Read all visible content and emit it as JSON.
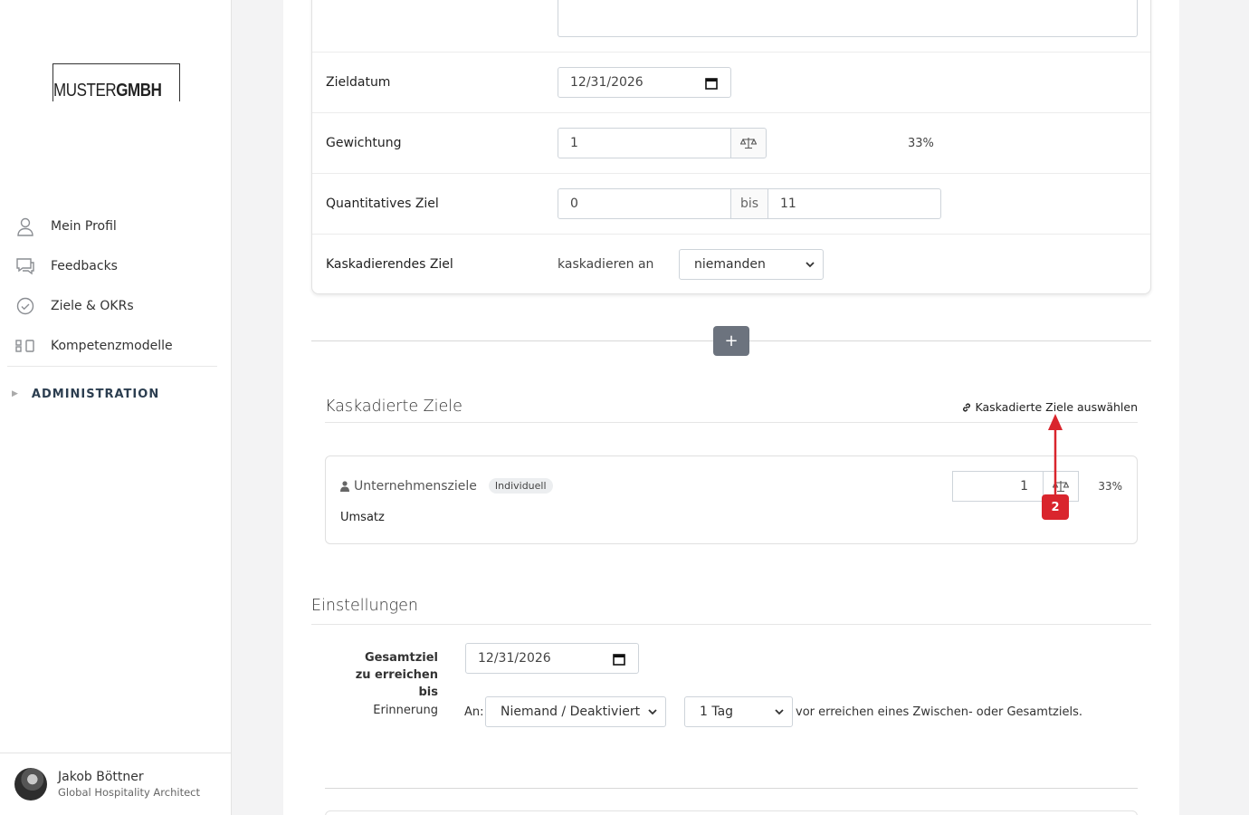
{
  "sidebar": {
    "logo_light": "MUSTER",
    "logo_bold": "GMBH",
    "nav": [
      {
        "label": "Mein Profil",
        "icon": "user-icon"
      },
      {
        "label": "Feedbacks",
        "icon": "chat-icon"
      },
      {
        "label": "Ziele & OKRs",
        "icon": "check-circle-icon"
      },
      {
        "label": "Kompetenzmodelle",
        "icon": "blocks-icon"
      }
    ],
    "admin_label": "ADMINISTRATION",
    "user": {
      "name": "Jakob Böttner",
      "role": "Global Hospitality Architect"
    }
  },
  "goal_form": {
    "zieldatum_label": "Zieldatum",
    "zieldatum_value": "12/31/2026",
    "gewichtung_label": "Gewichtung",
    "gewichtung_value": "1",
    "gewichtung_percent": "33%",
    "quant_label": "Quantitatives Ziel",
    "quant_from": "0",
    "quant_bis": "bis",
    "quant_to": "11",
    "kask_label": "Kaskadierendes Ziel",
    "kask_an": "kaskadieren an",
    "kask_select": "niemanden"
  },
  "add_button": "+",
  "cascaded": {
    "title": "Kaskadierte Ziele",
    "select_link": "Kaskadierte Ziele auswählen",
    "item": {
      "name": "Unternehmensziele",
      "badge": "Individuell",
      "subtitle": "Umsatz",
      "weight": "1",
      "percent": "33%"
    }
  },
  "annotation_marker": "2",
  "settings": {
    "title": "Einstellungen",
    "gesamtziel_label": "Gesamtziel zu erreichen bis",
    "gesamtziel_date": "12/31/2026",
    "erinnerung_label": "Erinnerung",
    "an_label": "An:",
    "an_select": "Niemand / Deaktiviert",
    "days_select": "1 Tag",
    "reminder_suffix": "vor erreichen eines Zwischen- oder Gesamtziels."
  },
  "colors": {
    "marker": "#d9252d",
    "plus_button": "#6c737e"
  }
}
